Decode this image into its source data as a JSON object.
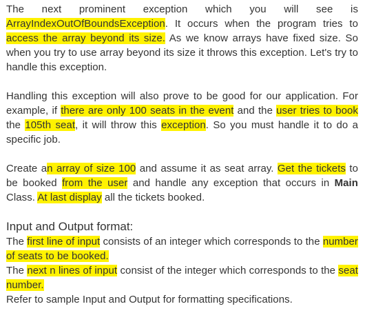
{
  "p1": {
    "t1": "The next prominent exception which you will see is ",
    "h1": "ArrayIndexOutOfBoundsException",
    "t2": ". It occurs when the program tries to ",
    "h2": "access the array beyond its size.",
    "t3": " As we know arrays have fixed size. So when you try to use array beyond its size it throws this exception. Let's try to handle this exception."
  },
  "p2": {
    "t1": "Handling this exception will also prove to be good for our application. For example, if ",
    "h1": "there are only 100 seats in the event",
    "t2": " and the ",
    "h2": "user tries to book",
    "t3": " the ",
    "h3": "105th seat",
    "t4": ", it will throw this ",
    "h4": "exception",
    "t5": ". So you must handle it to do a specific job."
  },
  "p3": {
    "t1": "Create a",
    "h1": "n array of size 100",
    "t2": " and assume it as seat array. ",
    "h2": "Get the tickets",
    "t3": " to be booked ",
    "h3": "from the user",
    "t4": " and handle any exception that occurs in ",
    "b1": "Main",
    "t5": " Class. ",
    "h4": "At last display",
    "t6": " all the tickets booked."
  },
  "section": {
    "heading": "Input and Output format:"
  },
  "p4": {
    "t1": "The ",
    "h1": "first line of input",
    "t2": " consists of an integer which corresponds to the ",
    "h2": "number of seats to be booked.",
    "t3": "The ",
    "h3": "next n lines of input",
    "t4": " consist of the integer which corresponds to the ",
    "h4": "seat number.",
    "t5": "Refer to sample Input and Output for formatting specifications."
  },
  "colors": {
    "highlight": "#fff200",
    "text": "#333333"
  }
}
